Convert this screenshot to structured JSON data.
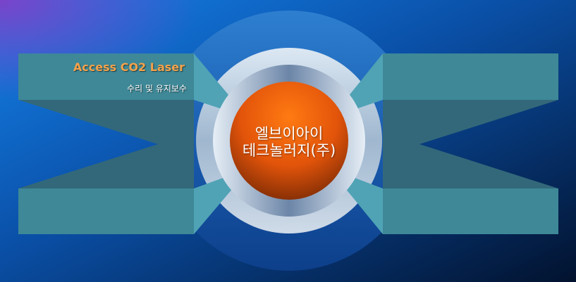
{
  "title": "Access CO2 Laser",
  "subtitle": "수리 및 유지보수",
  "company": {
    "line1": "엘브이아이",
    "line2": "테크놀러지(주)"
  },
  "colors": {
    "background": "#0a3f8f",
    "panel": "#3f8a99",
    "title": "#f5a24a",
    "center": "#f05a0a"
  }
}
